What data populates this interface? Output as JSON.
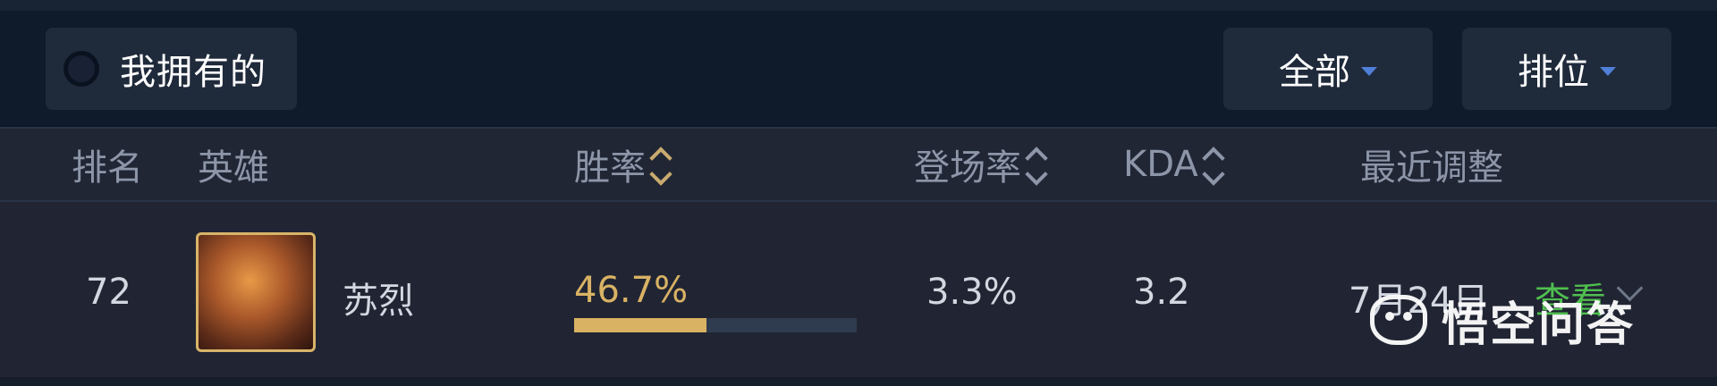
{
  "filters": {
    "owned_label": "我拥有的",
    "type_dropdown": "全部",
    "mode_dropdown": "排位"
  },
  "table": {
    "headers": {
      "rank": "排名",
      "hero": "英雄",
      "win_rate": "胜率",
      "pick_rate": "登场率",
      "kda": "KDA",
      "recent_adjust": "最近调整"
    },
    "rows": [
      {
        "rank": "72",
        "hero_name": "苏烈",
        "win_rate": "46.7%",
        "win_rate_fraction": 0.467,
        "pick_rate": "3.3%",
        "kda": "3.2",
        "recent_adjust": "7月24日",
        "action": "查看"
      }
    ]
  },
  "watermark": {
    "text": "悟空问答"
  },
  "colors": {
    "accent_gold": "#d9b264",
    "action_green": "#4fbf4f",
    "caret_blue": "#4f7fd6"
  },
  "icons": [
    "radio-circle-icon",
    "caret-down-icon",
    "sort-icon",
    "hero-portrait",
    "chevron-down-icon",
    "wukong-logo-icon"
  ]
}
